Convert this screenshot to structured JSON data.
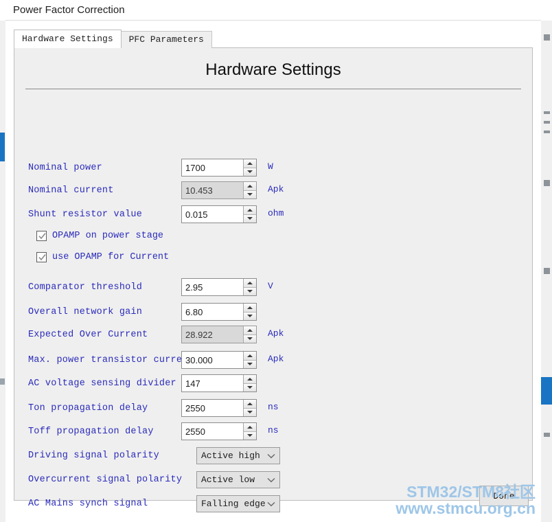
{
  "window": {
    "title": "Power Factor Correction"
  },
  "tabs": [
    {
      "label": "Hardware Settings",
      "active": true
    },
    {
      "label": "PFC Parameters",
      "active": false
    }
  ],
  "panel": {
    "heading": "Hardware Settings"
  },
  "fields": [
    {
      "label": "Nominal power",
      "value": "1700",
      "unit": "W",
      "type": "spinner",
      "disabled": false
    },
    {
      "label": "Nominal current",
      "value": "10.453",
      "unit": "Apk",
      "type": "spinner",
      "disabled": true
    },
    {
      "label": "Shunt resistor value",
      "value": "0.015",
      "unit": "ohm",
      "type": "spinner",
      "disabled": false
    },
    {
      "label": "OPAMP on power stage",
      "value": "",
      "unit": "",
      "type": "checkbox",
      "checked": true
    },
    {
      "label": "use OPAMP for Current",
      "value": "",
      "unit": "",
      "type": "checkbox",
      "checked": true
    },
    {
      "label": "Comparator threshold",
      "value": "2.95",
      "unit": "V",
      "type": "spinner",
      "disabled": false
    },
    {
      "label": "Overall network gain",
      "value": "6.80",
      "unit": "",
      "type": "spinner",
      "disabled": false
    },
    {
      "label": "Expected Over Current",
      "value": "28.922",
      "unit": "Apk",
      "type": "spinner",
      "disabled": true
    },
    {
      "label": "Max. power transistor current",
      "value": "30.000",
      "unit": "Apk",
      "type": "spinner",
      "disabled": false
    },
    {
      "label": "AC voltage sensing divider",
      "value": "147",
      "unit": "",
      "type": "spinner",
      "disabled": false
    },
    {
      "label": "Ton propagation delay",
      "value": "2550",
      "unit": "ns",
      "type": "spinner",
      "disabled": false
    },
    {
      "label": "Toff propagation delay",
      "value": "2550",
      "unit": "ns",
      "type": "spinner",
      "disabled": false
    },
    {
      "label": "Driving signal polarity",
      "value": "Active high",
      "unit": "",
      "type": "dropdown"
    },
    {
      "label": "Overcurrent signal polarity",
      "value": "Active low",
      "unit": "",
      "type": "dropdown"
    },
    {
      "label": "AC Mains synch signal",
      "value": "Falling edge",
      "unit": "",
      "type": "dropdown"
    }
  ],
  "actions": {
    "done_label": "Done"
  },
  "watermark": {
    "line1": "STM32/STM8社区",
    "line2": "www.stmcu.org.cn",
    "color": "#9ec6e8"
  },
  "colors": {
    "label_blue": "#2b2bbb",
    "panel_bg": "#efefef",
    "disabled_field": "#d9d9d9",
    "accent_blue": "#1a74c4"
  }
}
